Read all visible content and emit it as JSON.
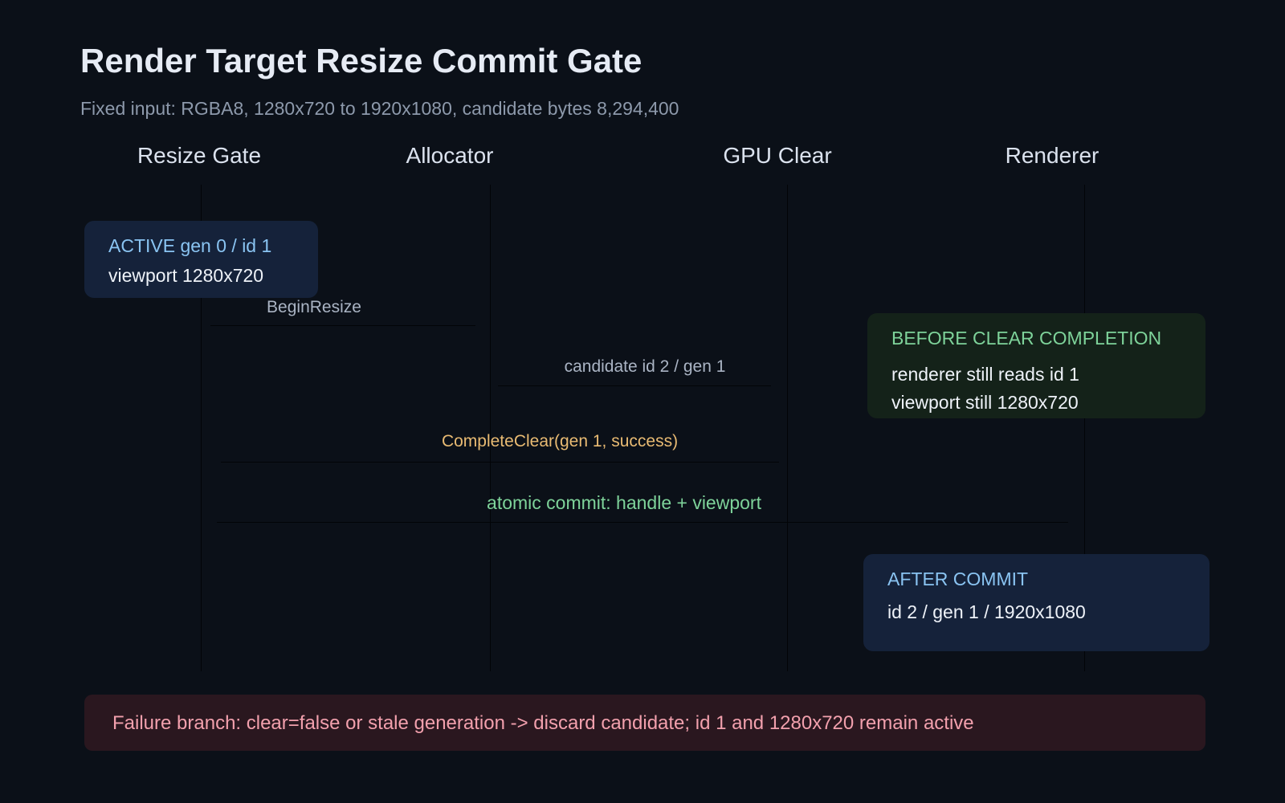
{
  "title": "Render Target Resize Commit Gate",
  "subtitle": "Fixed input: RGBA8, 1280x720 to 1920x1080, candidate bytes 8,294,400",
  "lanes": [
    "Resize Gate",
    "Allocator",
    "GPU Clear",
    "Renderer"
  ],
  "messages": [
    {
      "label": "BeginResize",
      "color": "#aab4c4"
    },
    {
      "label": "candidate id 2 / gen 1",
      "color": "#aab4c4"
    },
    {
      "label": "CompleteClear(gen 1, success)",
      "color": "#e9bb73"
    },
    {
      "label": "atomic commit: handle + viewport",
      "color": "#7ed39a"
    }
  ],
  "active_box": {
    "head": "ACTIVE gen 0 / id 1",
    "line": "viewport 1280x720"
  },
  "before_box": {
    "head": "BEFORE CLEAR COMPLETION",
    "line1": "renderer still reads id 1",
    "line2": "viewport still 1280x720"
  },
  "after_box": {
    "head": "AFTER COMMIT",
    "line": "id 2 / gen 1 / 1920x1080"
  },
  "failure": "Failure branch: clear=false or stale generation -> discard candidate; id 1 and 1280x720 remain active",
  "colors": {
    "background": "#0b1018",
    "active_head": "#8ac4f2",
    "before_head": "#7ed39a",
    "failure_text": "#f2a0ad"
  }
}
